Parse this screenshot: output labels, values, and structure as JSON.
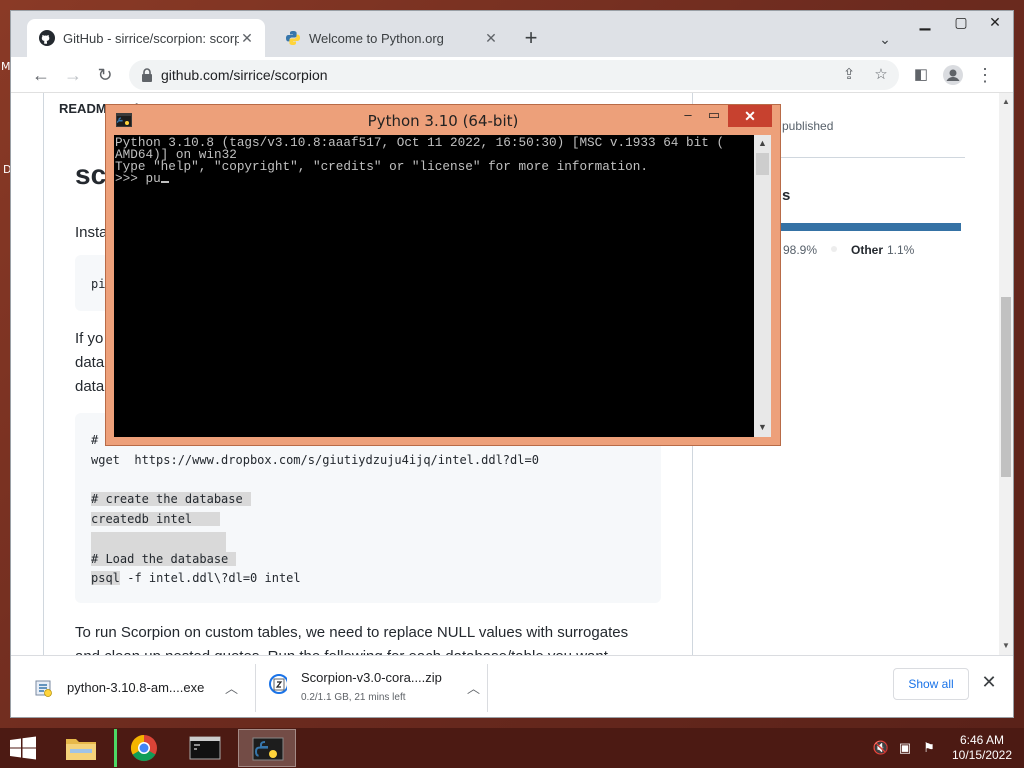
{
  "desktop": {
    "letters": [
      "M",
      "D"
    ]
  },
  "browser": {
    "tabs": [
      {
        "title": "GitHub - sirrice/scorpion: scorpio",
        "icon": "github-icon"
      },
      {
        "title": "Welcome to Python.org",
        "icon": "python-icon"
      }
    ],
    "url": "github.com/sirrice/scorpion"
  },
  "page": {
    "readme_title": "README.md",
    "heading": "sc",
    "p_install": "Insta",
    "code1": "pi",
    "p_if_lines": [
      "If yo",
      "data",
      "data"
    ],
    "code_block": {
      "hash_line": "#",
      "wget_line": "wget  https://www.dropbox.com/s/giutiydzuju4ijq/intel.ddl?dl=0",
      "comment_create": "# create the database",
      "createdb": "createdb intel",
      "comment_load": "# Load the database",
      "psql": "psql",
      "psql_rest": " -f intel.ddl\\?dl=0 intel"
    },
    "p_run_1": "To run Scorpion on custom tables, we need to replace NULL values with surrogates",
    "p_run_2": "and clean up nested quotes. Run the following for each database/table you want"
  },
  "sidebar": {
    "published": "published",
    "languages_heading": "s",
    "python_pct": "98.9%",
    "other_label": "Other",
    "other_pct": "1.1%"
  },
  "downloads": {
    "items": [
      {
        "name": "python-3.10.8-am....exe",
        "status": ""
      },
      {
        "name": "Scorpion-v3.0-cora....zip",
        "status": "0.2/1.1 GB, 21 mins left"
      }
    ],
    "show_all": "Show all"
  },
  "python_window": {
    "title": "Python 3.10 (64-bit)",
    "lines": [
      "Python 3.10.8 (tags/v3.10.8:aaaf517, Oct 11 2022, 16:50:30) [MSC v.1933 64 bit (",
      "AMD64)] on win32",
      "Type \"help\", \"copyright\", \"credits\" or \"license\" for more information."
    ],
    "prompt": ">>> pu"
  },
  "taskbar": {
    "time": "6:46 AM",
    "date": "10/15/2022"
  },
  "colors": {
    "console_bg": "#000000",
    "console_fg": "#c0c0c0",
    "python_frame": "#eda07a",
    "taskbar": "#4c1a13",
    "link": "#1a73e8"
  }
}
